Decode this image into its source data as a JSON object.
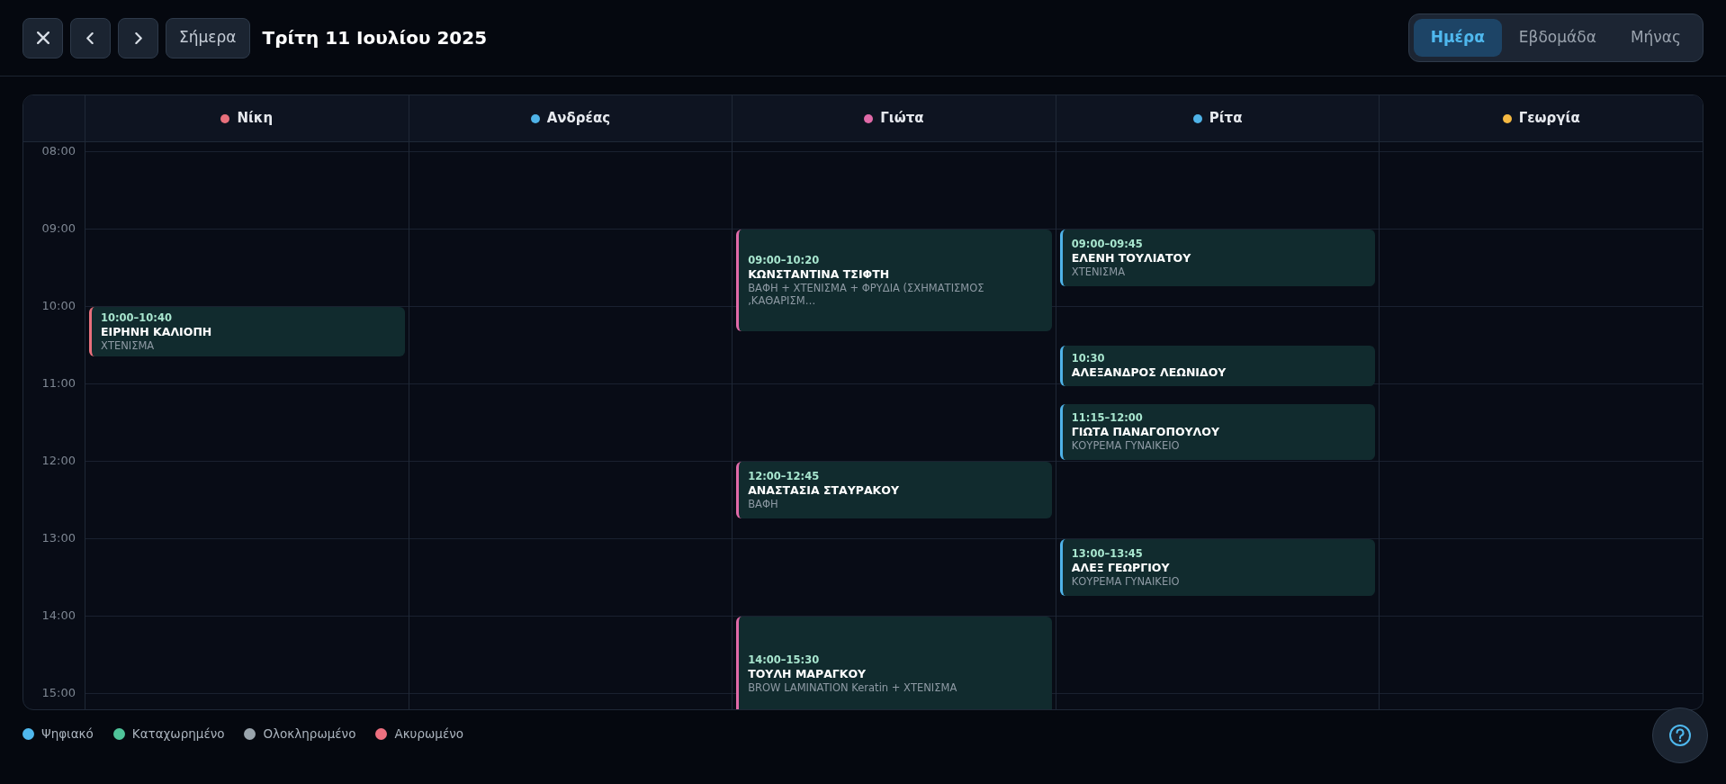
{
  "toolbar": {
    "nav_buttons": [
      {
        "kind": "close"
      },
      {
        "kind": "prev"
      },
      {
        "kind": "next"
      }
    ],
    "today_button": "Σήμερα",
    "date_title": "Τρίτη 11 Ιουλίου 2025"
  },
  "view_tabs": [
    {
      "label": "Ημέρα",
      "selected": true
    },
    {
      "label": "Εβδομάδα",
      "selected": false
    },
    {
      "label": "Μήνας",
      "selected": false
    }
  ],
  "hours": [
    "08:00",
    "09:00",
    "10:00",
    "11:00",
    "12:00",
    "13:00",
    "14:00",
    "15:00"
  ],
  "staff": [
    {
      "name": "Νίκη",
      "color": "#e8707c",
      "events": [
        {
          "time": "10:00–10:40",
          "client": "ΕΙΡΗΝΗ ΚΑΛΙΟΠΗ",
          "service": "ΧΤΕΝΙΣΜΑ"
        }
      ]
    },
    {
      "name": "Ανδρέας",
      "color": "#4fb3e8"
    },
    {
      "name": "Γιώτα",
      "color": "#e06aa8",
      "events": [
        {
          "time": "09:00–10:20",
          "client": "ΚΩΝΣΤΑΝΤΙΝΑ ΤΣΙΦΤΗ",
          "service": "ΒΑΦΗ + ΧΤΕΝΙΣΜΑ + ΦΡΥΔΙΑ (ΣΧΗΜΑΤΙΣΜΟΣ ,ΚΑΘΑΡΙΣΜ…"
        },
        {
          "time": "12:00–12:45",
          "client": "ΑΝΑΣΤΑΣΙΑ ΣΤΑΥΡΑΚΟΥ",
          "service": "ΒΑΦΗ"
        },
        {
          "time": "14:00–15:30",
          "client": "ΤΟΥΛΗ ΜΑΡΑΓΚΟΥ",
          "service": "BROW LAMINATION Keratin + ΧΤΕΝΙΣΜΑ"
        }
      ]
    },
    {
      "name": "Ρίτα",
      "color": "#4fb3e8",
      "events": [
        {
          "time": "09:00–09:45",
          "client": "ΕΛΕΝΗ ΤΟΥΛΙΑΤΟΥ",
          "service": "ΧΤΕΝΙΣΜΑ"
        },
        {
          "time": "10:30",
          "client": "ΑΛΕΞΑΝΔΡΟΣ ΛΕΩΝΙΔΟΥ"
        },
        {
          "time": "11:15–12:00",
          "client": "ΓΙΩΤΑ ΠΑΝΑΓΟΠΟΥΛΟΥ",
          "service": "ΚΟΥΡΕΜΑ ΓΥΝΑΙΚΕΙΟ"
        },
        {
          "time": "13:00–13:45",
          "client": "ΑΛΕΞ ΓΕΩΡΓΙΟΥ",
          "service": "ΚΟΥΡΕΜΑ ΓΥΝΑΙΚΕΙΟ"
        }
      ]
    },
    {
      "name": "Γεωργία",
      "color": "#f5b942"
    }
  ],
  "legend": [
    {
      "label": "Ψηφιακό",
      "color": "#4fb8ee"
    },
    {
      "label": "Καταχωρημένο",
      "color": "#4fc49a"
    },
    {
      "label": "Ολοκληρωμένο",
      "color": "#9aa5ad"
    },
    {
      "label": "Ακυρωμένο",
      "color": "#ee7080"
    }
  ]
}
